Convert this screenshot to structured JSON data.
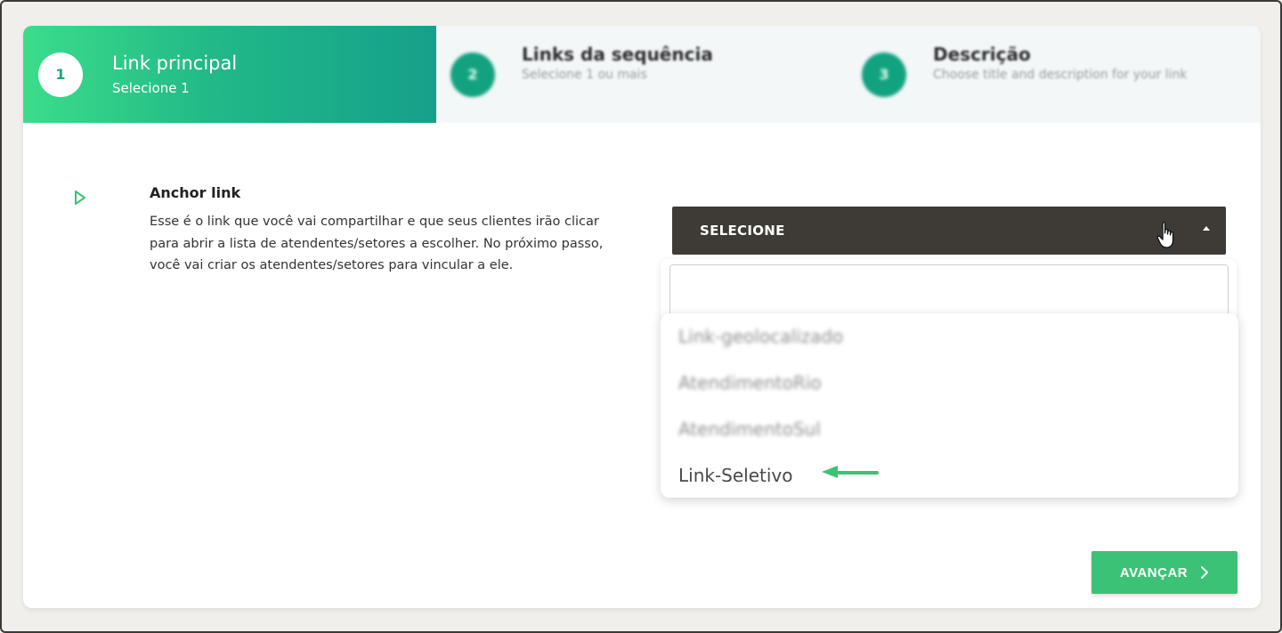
{
  "stepper": {
    "steps": [
      {
        "number": "1",
        "title": "Link principal",
        "subtitle": "Selecione 1"
      },
      {
        "number": "2",
        "title": "Links da sequência",
        "subtitle": "Selecione 1 ou mais"
      },
      {
        "number": "3",
        "title": "Descrição",
        "subtitle": "Choose title and description for your link"
      }
    ]
  },
  "anchor": {
    "title": "Anchor link",
    "description": "Esse é o link que você vai compartilhar e que seus clientes irão clicar para abrir a lista de atendentes/setores a escolher. No próximo passo, você vai criar os atendentes/setores para vincular a ele."
  },
  "select": {
    "label": "SELECIONE",
    "search_value": "",
    "options": [
      "Link-geolocalizado",
      "AtendimentoRio",
      "AtendimentoSul",
      "Link-Seletivo"
    ]
  },
  "actions": {
    "next_label": "AVANÇAR"
  },
  "colors": {
    "accent_green": "#3cc276",
    "gradient_start": "#3bdd8a",
    "gradient_end": "#15a08b",
    "select_bg": "#3e3a35"
  },
  "icons": {
    "marker": "play-outline-icon",
    "caret": "caret-up-icon",
    "cursor": "hand-pointer-icon",
    "annotation": "green-arrow-icon",
    "next": "chevron-right-icon"
  }
}
